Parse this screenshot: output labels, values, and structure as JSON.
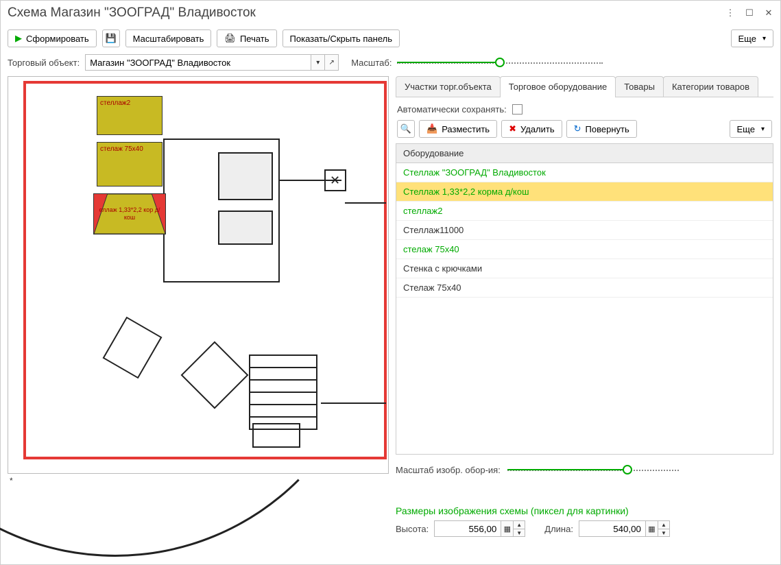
{
  "window": {
    "title": "Схема Магазин \"ЗООГРАД\" Владивосток"
  },
  "toolbar": {
    "generate": "Сформировать",
    "scale_btn": "Масштабировать",
    "print": "Печать",
    "toggle_panel": "Показать/Скрыть панель",
    "more": "Еще"
  },
  "trade_object": {
    "label": "Торговый объект:",
    "value": "Магазин \"ЗООГРАД\" Владивосток"
  },
  "scale": {
    "label": "Масштаб:"
  },
  "canvas": {
    "shelf2": "стеллаж2",
    "shelf75": "стелаж 75х40",
    "shelf133": "еллаж 1,33*2,2 кор д/кош"
  },
  "tabs": {
    "sections": "Участки торг.объекта",
    "equipment": "Торговое оборудование",
    "goods": "Товары",
    "categories": "Категории товаров"
  },
  "autosave": {
    "label": "Автоматически сохранять:"
  },
  "detail_toolbar": {
    "place": "Разместить",
    "delete": "Удалить",
    "rotate": "Повернуть",
    "more": "Еще"
  },
  "equipment": {
    "header": "Оборудование",
    "rows": [
      {
        "label": "Стеллаж \"ЗООГРАД\" Владивосток",
        "class": "green"
      },
      {
        "label": "Стеллаж 1,33*2,2 корма д/кош",
        "class": "selected"
      },
      {
        "label": "стеллаж2",
        "class": "green"
      },
      {
        "label": "Стеллаж11000",
        "class": ""
      },
      {
        "label": "стелаж 75х40",
        "class": "green"
      },
      {
        "label": "Стенка с крючками",
        "class": ""
      },
      {
        "label": "Стелаж 75х40",
        "class": ""
      }
    ]
  },
  "image_scale": {
    "label": "Масштаб изобр. обор-ия:"
  },
  "dimensions": {
    "title": "Размеры изображения схемы (пиксел для  картинки)",
    "height_label": "Высота:",
    "height_value": "556,00",
    "width_label": "Длина:",
    "width_value": "540,00"
  }
}
